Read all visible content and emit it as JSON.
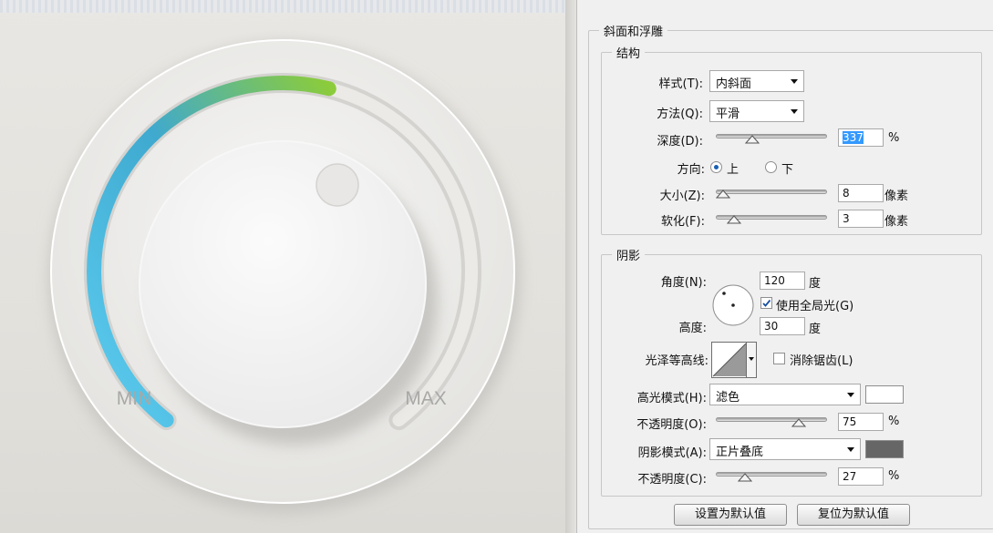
{
  "knob": {
    "min_label": "MIN",
    "max_label": "MAX",
    "value_fraction": 0.55,
    "colors": {
      "gradient_start": "#5ccdf0",
      "gradient_mid": "#3fa9cf",
      "gradient_end": "#8ccc3a"
    }
  },
  "panel": {
    "bevel_title": "斜面和浮雕",
    "structure_title": "结构",
    "style_label": "样式(T):",
    "style_value": "内斜面",
    "method_label": "方法(Q):",
    "method_value": "平滑",
    "depth_label": "深度(D):",
    "depth_value": "337",
    "depth_unit": "%",
    "direction_label": "方向:",
    "direction_up": "上",
    "direction_down": "下",
    "size_label": "大小(Z):",
    "size_value": "8",
    "size_unit": "像素",
    "soften_label": "软化(F):",
    "soften_value": "3",
    "soften_unit": "像素",
    "shading_title": "阴影",
    "angle_label": "角度(N):",
    "angle_value": "120",
    "angle_unit": "度",
    "global_light_label": "使用全局光(G)",
    "altitude_label": "高度:",
    "altitude_value": "30",
    "altitude_unit": "度",
    "gloss_label": "光泽等高线:",
    "antialias_label": "消除锯齿(L)",
    "highlight_mode_label": "高光模式(H):",
    "highlight_mode_value": "滤色",
    "highlight_color": "#ffffff",
    "highlight_opacity_label": "不透明度(O):",
    "highlight_opacity_value": "75",
    "highlight_opacity_unit": "%",
    "shadow_mode_label": "阴影模式(A):",
    "shadow_mode_value": "正片叠底",
    "shadow_color": "#666666",
    "shadow_opacity_label": "不透明度(C):",
    "shadow_opacity_value": "27",
    "shadow_opacity_unit": "%",
    "set_default_button": "设置为默认值",
    "reset_default_button": "复位为默认值"
  }
}
